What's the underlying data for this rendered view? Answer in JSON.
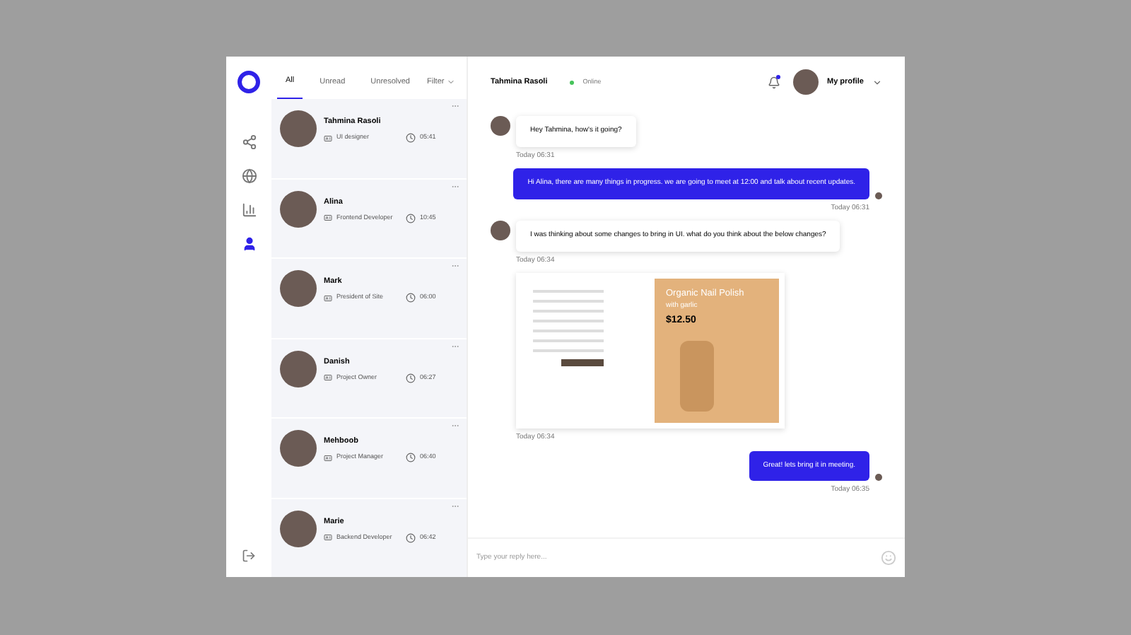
{
  "tabs": [
    {
      "label": "All",
      "selected": true
    },
    {
      "label": "Unread",
      "selected": false
    },
    {
      "label": "Unresolved",
      "selected": false
    }
  ],
  "filter": {
    "label": "Filter"
  },
  "contacts": [
    {
      "name": "Tahmina Rasoli",
      "role": "UI designer",
      "time": "05:41"
    },
    {
      "name": "Alina",
      "role": "Frontend Developer",
      "time": "10:45"
    },
    {
      "name": "Mark",
      "role": "President of Site",
      "time": "06:00"
    },
    {
      "name": "Danish",
      "role": "Project Owner",
      "time": "06:27"
    },
    {
      "name": "Mehboob",
      "role": "Project Manager",
      "time": "06:40"
    },
    {
      "name": "Marie",
      "role": "Backend Developer",
      "time": "06:42"
    }
  ],
  "chat_header": {
    "name": "Tahmina Rasoli",
    "status": "Online",
    "notification": true,
    "profile": "My profile"
  },
  "messages": [
    {
      "kind": "text",
      "incoming": true,
      "text": "Hey Tahmina, how's it going?",
      "time": "Today 06:31"
    },
    {
      "kind": "text",
      "incoming": false,
      "text": "Hi Alina, there are many things in progress. we are going to meet at 12:00 and talk about recent updates.",
      "time": "Today 06:31"
    },
    {
      "kind": "text",
      "incoming": true,
      "text": "I was thinking about some changes to bring in UI. what do you think about the below changes?",
      "time": "Today 06:34"
    },
    {
      "kind": "image",
      "incoming": true,
      "title": "Organic Nail Polish",
      "subtitle": "with garlic",
      "price": "$12.50",
      "time": "Today 06:34"
    },
    {
      "kind": "text",
      "incoming": false,
      "text": "Great! lets bring it in meeting.",
      "time": "Today 06:35"
    }
  ],
  "composer": {
    "placeholder": "Type your reply here..."
  }
}
